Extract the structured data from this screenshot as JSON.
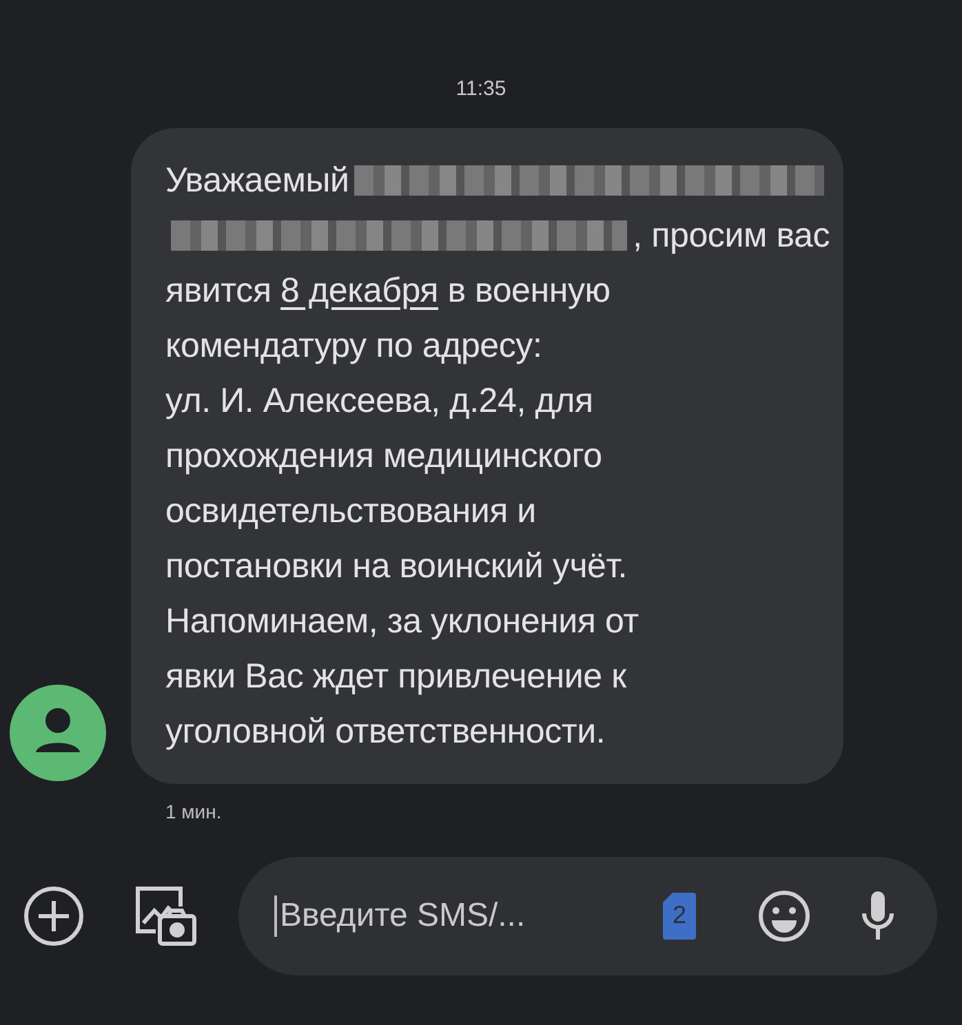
{
  "timestamp": "11:35",
  "message": {
    "lines": [
      [
        {
          "kind": "text",
          "text": "Уважаемый"
        },
        {
          "kind": "redacted"
        }
      ],
      [
        {
          "kind": "redacted"
        },
        {
          "kind": "text",
          "text": ", просим вас"
        }
      ],
      [
        {
          "kind": "text",
          "text": "явится "
        },
        {
          "kind": "link",
          "text": "8 декабря"
        },
        {
          "kind": "text",
          "text": " в военную"
        }
      ],
      [
        {
          "kind": "text",
          "text": "комендатуру по адресу:"
        }
      ],
      [
        {
          "kind": "text",
          "text": "ул. И. Алексеева, д.24, для"
        }
      ],
      [
        {
          "kind": "text",
          "text": "прохождения медицинского"
        }
      ],
      [
        {
          "kind": "text",
          "text": "освидетельствования и"
        }
      ],
      [
        {
          "kind": "text",
          "text": "постановки на воинский учёт."
        }
      ],
      [
        {
          "kind": "text",
          "text": "Напоминаем, за уклонения от"
        }
      ],
      [
        {
          "kind": "text",
          "text": "явки Вас ждет привлечение к"
        }
      ],
      [
        {
          "kind": "text",
          "text": "уголовной ответственности."
        }
      ]
    ],
    "time": "1 мин."
  },
  "composer": {
    "placeholder": "Введите SMS/...",
    "sim": "2"
  }
}
